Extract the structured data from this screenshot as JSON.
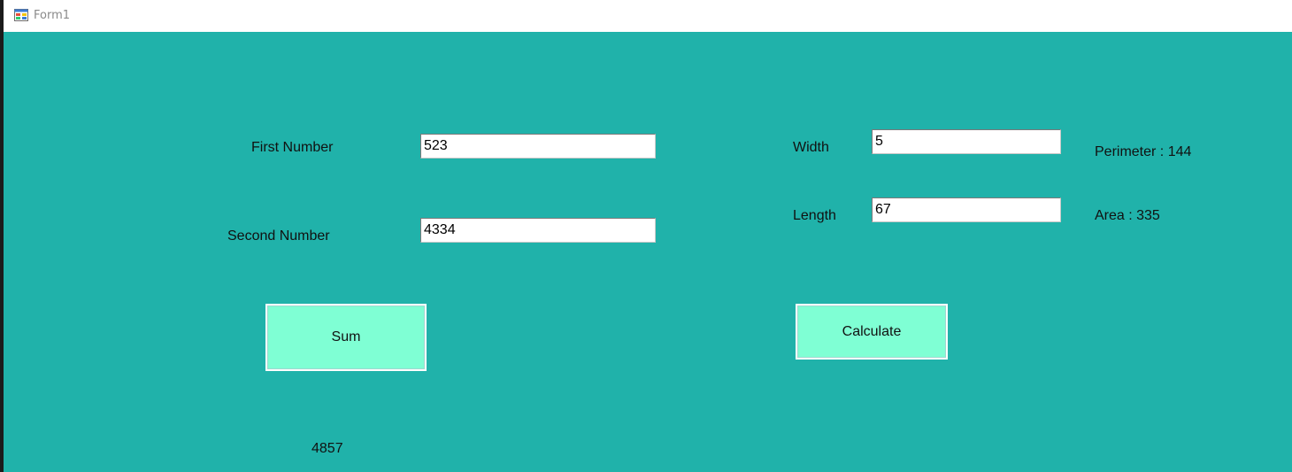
{
  "window": {
    "title": "Form1",
    "icon": "form-app-icon",
    "background_color": "#20b2aa"
  },
  "sum_panel": {
    "first_number_label": "First Number",
    "first_number_value": "523",
    "second_number_label": "Second Number",
    "second_number_value": "4334",
    "sum_button_label": "Sum",
    "result": "4857"
  },
  "rect_panel": {
    "width_label": "Width",
    "width_value": "5",
    "length_label": "Length",
    "length_value": "67",
    "calculate_button_label": "Calculate",
    "perimeter_text": "Perimeter : 144",
    "area_text": "Area : 335"
  },
  "colors": {
    "button_background": "#7fffd4",
    "text": "#111111"
  }
}
